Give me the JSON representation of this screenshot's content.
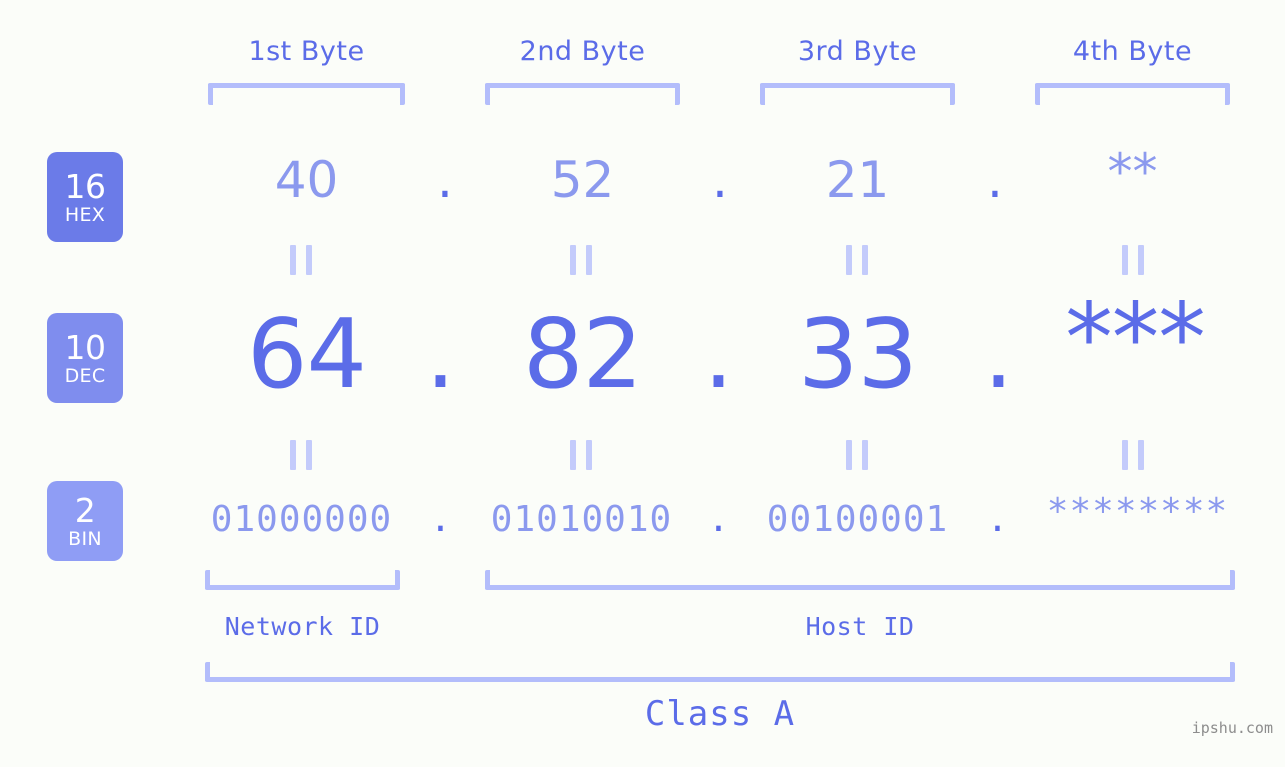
{
  "background_color": "#fbfdf9",
  "accent_color": "#5b6ce8",
  "accent_light_color": "#8b99ee",
  "bracket_color": "#b3bdfb",
  "byte_headers": [
    {
      "label": "1st Byte"
    },
    {
      "label": "2nd Byte"
    },
    {
      "label": "3rd Byte"
    },
    {
      "label": "4th Byte"
    }
  ],
  "rows": [
    {
      "radix": "16",
      "abbr": "HEX",
      "badge_color": "#6b7be8",
      "values": [
        "40",
        "52",
        "21",
        "**"
      ],
      "separator": "."
    },
    {
      "radix": "10",
      "abbr": "DEC",
      "badge_color": "#7f8dee",
      "values": [
        "64",
        "82",
        "33",
        "***"
      ],
      "separator": "."
    },
    {
      "radix": "2",
      "abbr": "BIN",
      "badge_color": "#8f9df5",
      "values": [
        "01000000",
        "01010010",
        "00100001",
        "********"
      ],
      "separator": "."
    }
  ],
  "equals_marker": "=",
  "id_sections": [
    {
      "label": "Network ID"
    },
    {
      "label": "Host ID"
    }
  ],
  "class_label": "Class A",
  "watermark": "ipshu.com"
}
